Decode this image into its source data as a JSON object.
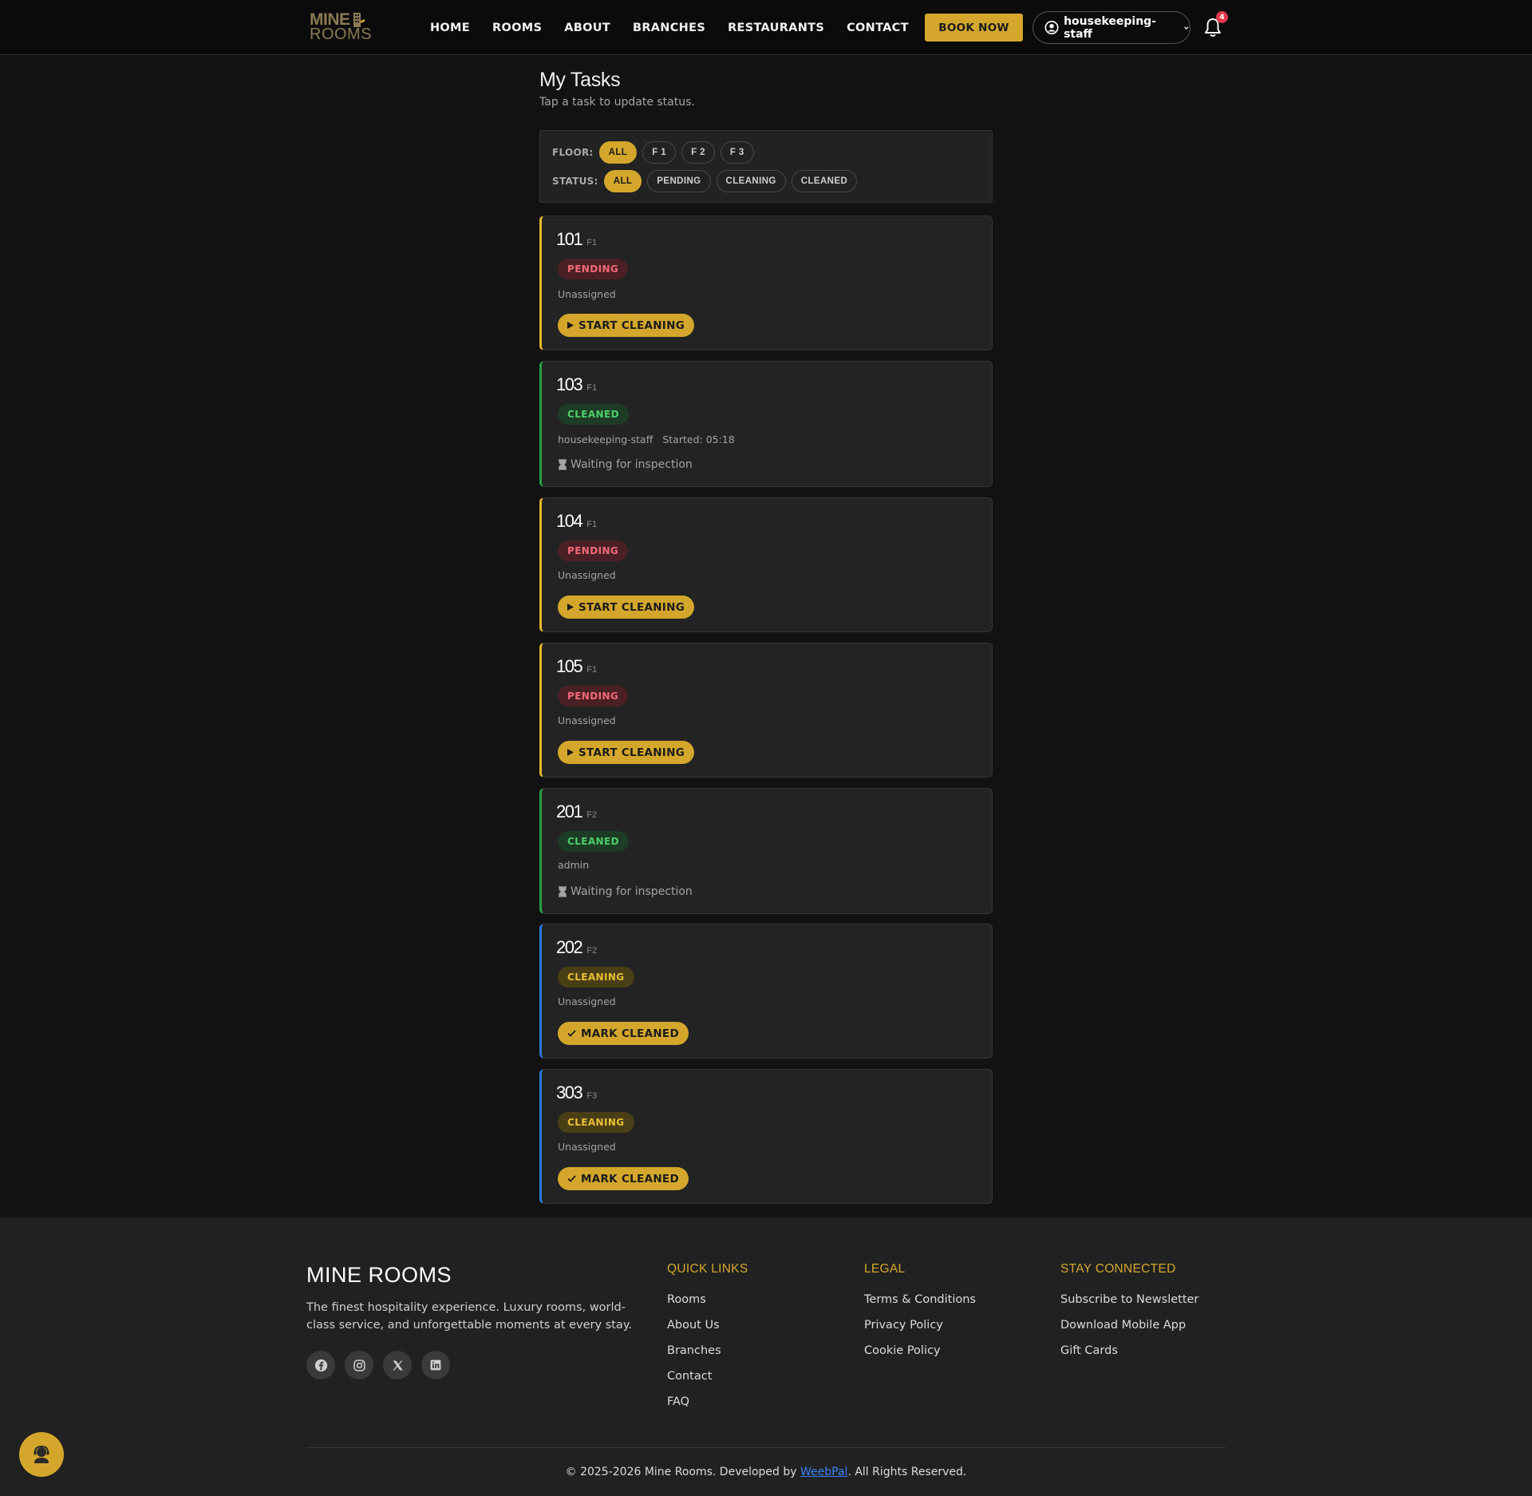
{
  "header": {
    "logo_line1": "MINE",
    "logo_line2": "ROOMS",
    "nav": [
      "HOME",
      "ROOMS",
      "ABOUT",
      "BRANCHES",
      "RESTAURANTS",
      "CONTACT"
    ],
    "book_now": "BOOK NOW",
    "user": "housekeeping-staff",
    "notification_count": "4"
  },
  "main": {
    "title": "My Tasks",
    "subtitle": "Tap a task to update status.",
    "filters": {
      "floor_label": "FLOOR:",
      "floor_options": [
        "ALL",
        "F 1",
        "F 2",
        "F 3"
      ],
      "floor_selected": "ALL",
      "status_label": "STATUS:",
      "status_options": [
        "ALL",
        "PENDING",
        "CLEANING",
        "CLEANED"
      ],
      "status_selected": "ALL"
    },
    "tasks": [
      {
        "room": "101",
        "floor": "F1",
        "status": "PENDING",
        "assignee": "Unassigned",
        "started": "",
        "action": "START CLEANING"
      },
      {
        "room": "103",
        "floor": "F1",
        "status": "CLEANED",
        "assignee": "housekeeping-staff",
        "started": "Started: 05:18",
        "note": "Waiting for inspection"
      },
      {
        "room": "104",
        "floor": "F1",
        "status": "PENDING",
        "assignee": "Unassigned",
        "started": "",
        "action": "START CLEANING"
      },
      {
        "room": "105",
        "floor": "F1",
        "status": "PENDING",
        "assignee": "Unassigned",
        "started": "",
        "action": "START CLEANING"
      },
      {
        "room": "201",
        "floor": "F2",
        "status": "CLEANED",
        "assignee": "admin",
        "started": "",
        "note": "Waiting for inspection"
      },
      {
        "room": "202",
        "floor": "F2",
        "status": "CLEANING",
        "assignee": "Unassigned",
        "started": "",
        "action": "MARK CLEANED"
      },
      {
        "room": "303",
        "floor": "F3",
        "status": "CLEANING",
        "assignee": "Unassigned",
        "started": "",
        "action": "MARK CLEANED"
      }
    ]
  },
  "footer": {
    "brand": "MINE ROOMS",
    "description": "The finest hospitality experience. Luxury rooms, world-class service, and unforgettable moments at every stay.",
    "quick_links_title": "QUICK LINKS",
    "quick_links": [
      "Rooms",
      "About Us",
      "Branches",
      "Contact",
      "FAQ"
    ],
    "legal_title": "LEGAL",
    "legal_links": [
      "Terms & Conditions",
      "Privacy Policy",
      "Cookie Policy"
    ],
    "connected_title": "STAY CONNECTED",
    "connected_links": [
      "Subscribe to Newsletter",
      "Download Mobile App",
      "Gift Cards"
    ],
    "copyright_prefix": "© 2025-2026 Mine Rooms. Developed by ",
    "developer": "WeebPal",
    "copyright_suffix": ". All Rights Reserved."
  },
  "colors": {
    "accent": "#d4a72c",
    "pending": "#e5b82c",
    "cleaned": "#27a047",
    "cleaning": "#2a79e0"
  }
}
